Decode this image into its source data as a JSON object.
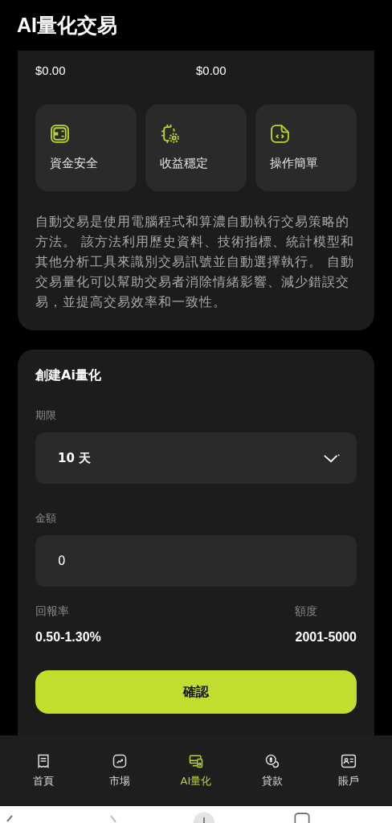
{
  "header": {
    "title": "AI量化交易"
  },
  "summary": {
    "values": [
      "$0.00",
      "$0.00"
    ]
  },
  "features": [
    {
      "kind": "wallet",
      "label": "資金安全"
    },
    {
      "kind": "chip",
      "label": "收益穩定"
    },
    {
      "kind": "code",
      "label": "操作簡單"
    }
  ],
  "description": "自動交易是使用電腦程式和算濃自動執行交易策略的方法。 該方法利用歷史資料、技術指標、統計模型和其他分析工具來識別交易訊號並自動選擇執行。 自動交易量化可以幫助交易者消除情緒影響、減少錯誤交易，並提高交易效率和一致性。",
  "create_form": {
    "title": "創建Ai量化",
    "period": {
      "label": "期限",
      "value": "10 天"
    },
    "amount": {
      "label": "金額",
      "value": "0"
    },
    "stats": [
      {
        "label": "回報率",
        "value": "0.50-1.30%"
      },
      {
        "label": "額度",
        "value": "2001-5000"
      }
    ],
    "confirm_button": "確認"
  },
  "bottom_nav": [
    {
      "kind": "home",
      "label": "首頁",
      "selected": false
    },
    {
      "kind": "market",
      "label": "市場",
      "selected": false
    },
    {
      "kind": "ai",
      "label": "AI量化",
      "selected": true
    },
    {
      "kind": "loan",
      "label": "貸款",
      "selected": false
    },
    {
      "kind": "account",
      "label": "賬戶",
      "selected": false
    }
  ]
}
